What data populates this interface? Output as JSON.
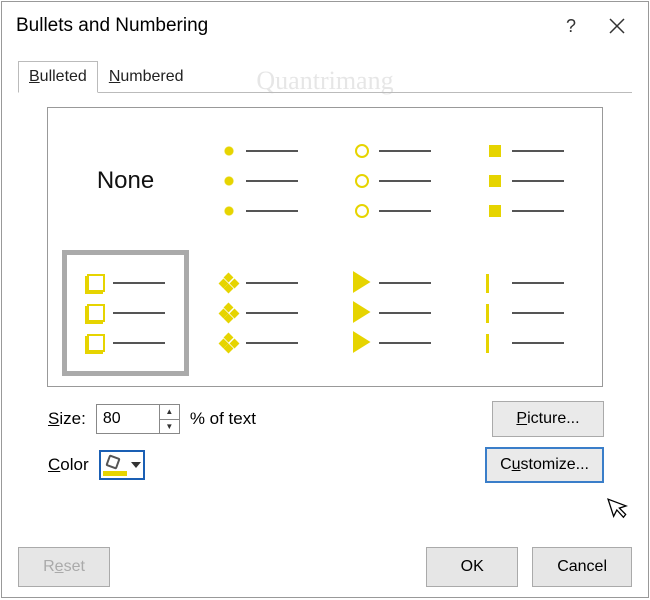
{
  "window": {
    "title": "Bullets and Numbering"
  },
  "tabs": {
    "bulleted": "Bulleted",
    "numbered": "Numbered"
  },
  "options": {
    "none": "None"
  },
  "size": {
    "label": "Size:",
    "value": "80",
    "suffix": "% of text"
  },
  "color": {
    "label": "Color"
  },
  "buttons": {
    "picture": "Picture...",
    "customize": "Customize...",
    "reset": "Reset",
    "ok": "OK",
    "cancel": "Cancel"
  },
  "watermark": "Quantrimang"
}
